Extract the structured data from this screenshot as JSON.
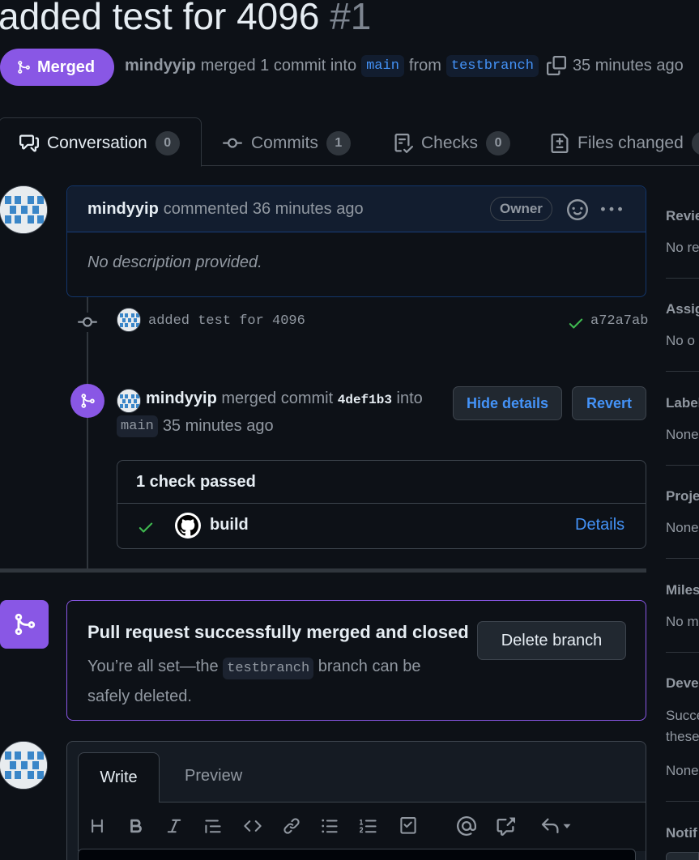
{
  "pr": {
    "title": "added test for 4096",
    "number": "#1",
    "state_label": "Merged",
    "author": "mindyyip",
    "merge_summary": "merged 1 commit into",
    "base_branch": "main",
    "from_word": "from",
    "head_branch": "testbranch",
    "time_ago": "35 minutes ago"
  },
  "tabs": [
    {
      "label": "Conversation",
      "count": "0"
    },
    {
      "label": "Commits",
      "count": "1"
    },
    {
      "label": "Checks",
      "count": "0"
    },
    {
      "label": "Files changed",
      "count": ""
    }
  ],
  "comment": {
    "author": "mindyyip",
    "action": "commented 36 minutes ago",
    "badge": "Owner",
    "body": "No description provided."
  },
  "commit": {
    "message": "added test for 4096",
    "sha": "a72a7ab"
  },
  "merge_event": {
    "author": "mindyyip",
    "text_a": "merged commit",
    "sha": "4def1b3",
    "text_b": "into",
    "branch": "main",
    "time_ago": "35 minutes ago",
    "hide_details_label": "Hide details",
    "revert_label": "Revert"
  },
  "checks": {
    "header": "1 check passed",
    "items": [
      {
        "name": "build",
        "link": "Details"
      }
    ]
  },
  "merged_box": {
    "title": "Pull request successfully merged and closed",
    "desc_a": "You’re all set—the",
    "branch": "testbranch",
    "desc_b": "branch can be safely deleted.",
    "delete_label": "Delete branch"
  },
  "editor": {
    "write_tab": "Write",
    "preview_tab": "Preview"
  },
  "sidebar": {
    "reviewers": {
      "label": "Revie",
      "value": "No re"
    },
    "assignees": {
      "label": "Assig",
      "value": "No o"
    },
    "labels": {
      "label": "Label",
      "value": "None"
    },
    "projects": {
      "label": "Proje",
      "value": "None"
    },
    "milestone": {
      "label": "Miles",
      "value": "No m"
    },
    "development": {
      "label": "Deve",
      "value_a": "Succe",
      "value_b": "these",
      "value_c": "None"
    },
    "notifications": {
      "label": "Notif"
    }
  },
  "colors": {
    "merged": "#8957e5",
    "link": "#4493f8",
    "success": "#3fb950",
    "background": "#0d1117"
  }
}
